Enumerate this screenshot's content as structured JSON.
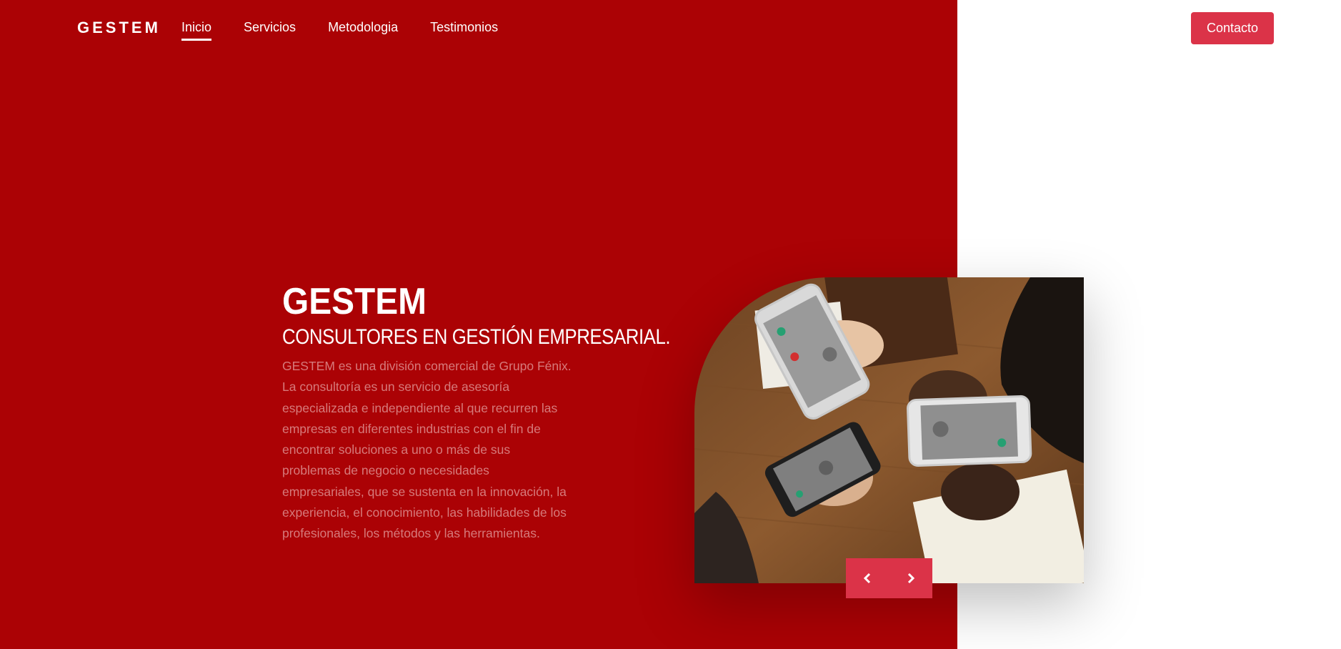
{
  "brand": {
    "logo_text": "GESTEM"
  },
  "nav": {
    "items": [
      {
        "label": "Inicio",
        "active": true
      },
      {
        "label": "Servicios",
        "active": false
      },
      {
        "label": "Metodologia",
        "active": false
      },
      {
        "label": "Testimonios",
        "active": false
      }
    ],
    "contact_label": "Contacto"
  },
  "hero": {
    "title": "GESTEM",
    "subtitle": "CONSULTORES EN GESTIÓN EMPRESARIAL.",
    "description": "GESTEM es una división comercial de Grupo Fénix. La consultoría es un servicio de asesoría especializada e independiente al que recurren las empresas en diferentes industrias con el fin de encontrar soluciones a uno o más de sus problemas de negocio o necesidades empresariales, que se sustenta en la innovación, la experiencia, el conocimiento, las habilidades de los profesionales, los métodos y las herramientas."
  },
  "slider": {
    "prev_icon": "chevron-left-icon",
    "next_icon": "chevron-right-icon"
  },
  "colors": {
    "primary_red": "#ab0205",
    "accent_red": "#db3348",
    "white": "#ffffff",
    "description_text": "#d67a7b"
  }
}
